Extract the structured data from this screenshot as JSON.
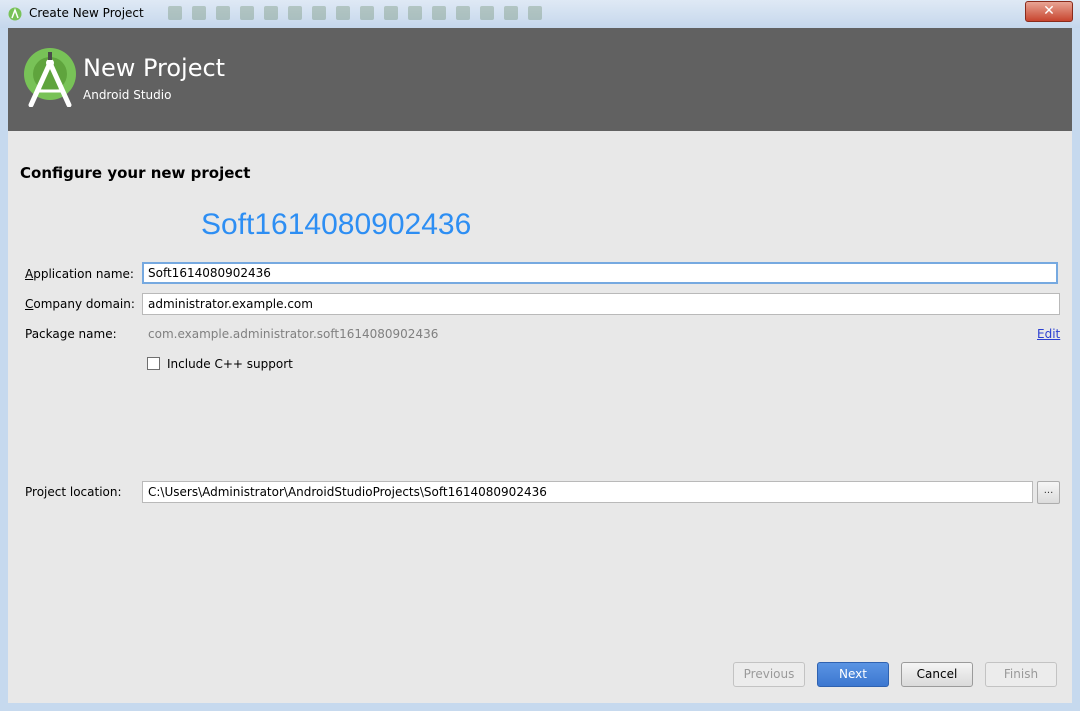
{
  "window": {
    "title": "Create New Project",
    "close_label": "✕"
  },
  "header": {
    "title": "New Project",
    "subtitle": "Android Studio"
  },
  "page": {
    "section_title": "Configure your new project",
    "app_name_display": "Soft1614080902436"
  },
  "form": {
    "app_name_label_prefix": "A",
    "app_name_label_rest": "pplication name:",
    "app_name_value": "Soft1614080902436",
    "company_label_prefix": "C",
    "company_label_rest": "ompany domain:",
    "company_value": "administrator.example.com",
    "package_label": "Package name:",
    "package_value": "com.example.administrator.soft1614080902436",
    "edit_label": "Edit",
    "cpp_label": "Include C++ support",
    "cpp_checked": false,
    "location_label": "Project location:",
    "location_value": "C:\\Users\\Administrator\\AndroidStudioProjects\\Soft1614080902436",
    "browse_label": "..."
  },
  "buttons": {
    "previous": "Previous",
    "next": "Next",
    "cancel": "Cancel",
    "finish": "Finish"
  },
  "colors": {
    "header_bg": "#616161",
    "accent_blue": "#2d8ef3",
    "primary_button": "#3c77d0",
    "logo_green": "#78c257"
  },
  "icons": {
    "app_icon": "android-studio-icon",
    "logo": "android-studio-logo"
  }
}
